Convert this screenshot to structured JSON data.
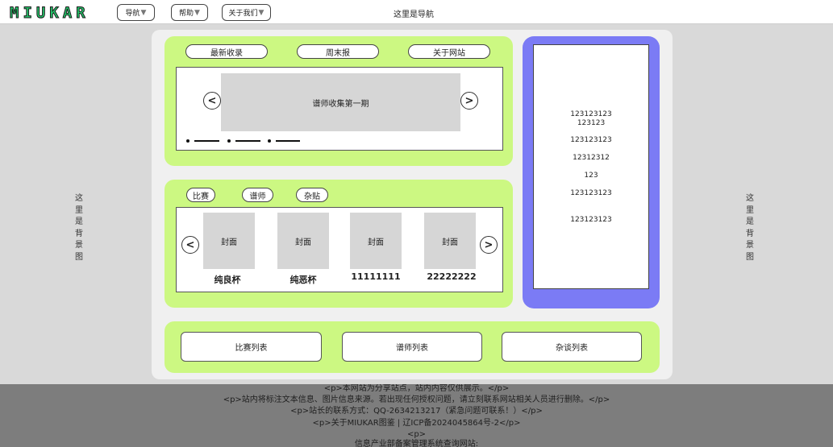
{
  "header": {
    "logo": "MIUKAR",
    "nav_buttons": [
      "导航",
      "帮助",
      "关于我们"
    ],
    "nav_title": "这里是导航"
  },
  "background_label": "这里是背景图",
  "top_panel": {
    "tabs": [
      "最新收录",
      "周末报",
      "关于网站"
    ],
    "carousel_slide": "谱师收集第一期"
  },
  "category_panel": {
    "tabs": [
      "比赛",
      "谱师",
      "杂贴"
    ],
    "cover_label": "封面",
    "cards": [
      {
        "cover": "封面",
        "title": "纯良杯"
      },
      {
        "cover": "封面",
        "title": "纯恶杯"
      },
      {
        "cover": "封面",
        "title": "11111111"
      },
      {
        "cover": "封面",
        "title": "22222222"
      }
    ]
  },
  "sidebar": {
    "items": [
      "123123123\n123123",
      "123123123",
      "12312312",
      "123",
      "123123123",
      "123123123"
    ]
  },
  "list_buttons": [
    "比赛列表",
    "谱师列表",
    "杂谈列表"
  ],
  "footer": {
    "lines": [
      "<p>本网站为分享站点，站内内容仅供展示。</p>",
      "<p>站内将标注文本信息、图片信息来源。若出现任何授权问题，请立刻联系网站相关人员进行删除。</p>",
      "<p>站长的联系方式：QQ-2634213217（紧急问题可联系！）</p>",
      "<p>关于MIUKAR图鉴 | 辽ICP备2024045864号-2</p>",
      "<p>",
      "信息产业部备案管理系统查询网站:"
    ]
  },
  "colors": {
    "panel_green": "#ccf882",
    "sidebar_purple": "#7b7bf5",
    "logo_green": "#25c36a",
    "footer_gray": "#7d7d7d"
  }
}
